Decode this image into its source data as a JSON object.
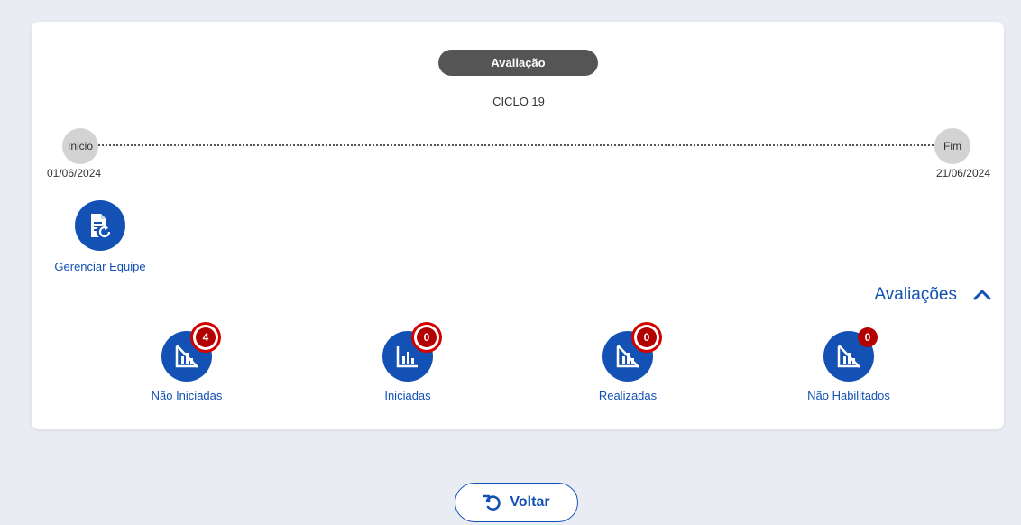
{
  "header": {
    "stage_label": "Avaliação",
    "cycle_label": "CICLO 19"
  },
  "timeline": {
    "start_label": "Inicio",
    "start_date": "01/06/2024",
    "end_label": "Fim",
    "end_date": "21/06/2024"
  },
  "manage": {
    "label": "Gerenciar Equipe",
    "icon": "document-refresh-icon"
  },
  "evaluations": {
    "title": "Avaliações",
    "expanded": true,
    "items": [
      {
        "label": "Não Iniciadas",
        "count": "4",
        "icon": "chart-off-icon",
        "highlight": true
      },
      {
        "label": "Iniciadas",
        "count": "0",
        "icon": "bar-chart-icon",
        "highlight": true
      },
      {
        "label": "Realizadas",
        "count": "0",
        "icon": "chart-off-icon",
        "highlight": true
      },
      {
        "label": "Não Habilitados",
        "count": "0",
        "icon": "chart-off-icon",
        "highlight": false
      }
    ]
  },
  "footer": {
    "back_label": "Voltar",
    "icon": "undo-icon"
  },
  "colors": {
    "primary": "#1351b4",
    "badge": "#b30000",
    "pill": "#555555",
    "background": "#e9ecf3"
  }
}
